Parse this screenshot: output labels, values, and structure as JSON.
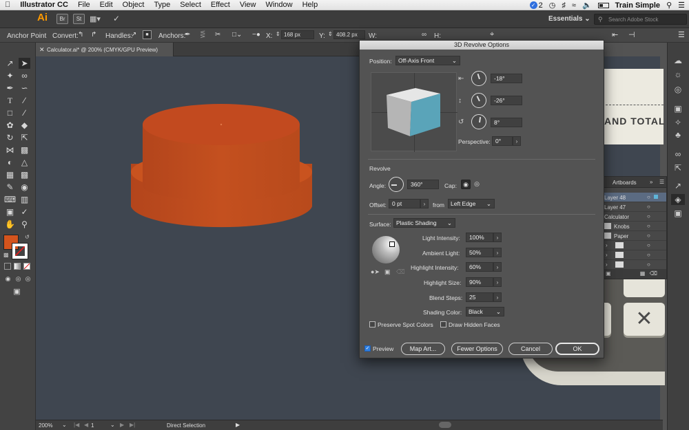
{
  "menubar": {
    "app_name": "Illustrator CC",
    "items": [
      "File",
      "Edit",
      "Object",
      "Type",
      "Select",
      "Effect",
      "View",
      "Window",
      "Help"
    ],
    "notif_count": "2",
    "user": "Train Simple"
  },
  "appbar": {
    "ai_label": "Ai",
    "br_label": "Br",
    "st_label": "St",
    "workspace": "Essentials",
    "stock_placeholder": "Search Adobe Stock"
  },
  "control": {
    "anchor_point": "Anchor Point",
    "convert": "Convert:",
    "handles": "Handles:",
    "anchors": "Anchors:",
    "x_label": "X:",
    "x_value": "168 px",
    "y_label": "Y:",
    "y_value": "408.2 px",
    "w_label": "W:",
    "h_label": "H:"
  },
  "tab": {
    "title": "Calculator.ai* @ 200% (CMYK/GPU Preview)"
  },
  "status": {
    "zoom": "200%",
    "page": "1",
    "tool": "Direct Selection"
  },
  "layers": {
    "tab_artboards": "Artboards",
    "rows": [
      "Layer 48",
      "Layer 47",
      "Calculator",
      "Knobs",
      "Paper"
    ]
  },
  "artwork": {
    "receipt_text": "AND TOTAL"
  },
  "dialog": {
    "title": "3D Revolve Options",
    "position_label": "Position:",
    "position_value": "Off-Axis Front",
    "rot_x": "-18°",
    "rot_y": "-26°",
    "rot_z": "8°",
    "perspective_label": "Perspective:",
    "perspective_value": "0°",
    "revolve_header": "Revolve",
    "angle_label": "Angle:",
    "angle_value": "360°",
    "cap_label": "Cap:",
    "offset_label": "Offset:",
    "offset_value": "0 pt",
    "from_label": "from",
    "from_value": "Left Edge",
    "surface_label": "Surface:",
    "surface_value": "Plastic Shading",
    "light_intensity_label": "Light Intensity:",
    "light_intensity_value": "100%",
    "ambient_label": "Ambient Light:",
    "ambient_value": "50%",
    "highlight_int_label": "Highlight Intensity:",
    "highlight_int_value": "60%",
    "highlight_size_label": "Highlight Size:",
    "highlight_size_value": "90%",
    "blend_label": "Blend Steps:",
    "blend_value": "25",
    "shading_label": "Shading Color:",
    "shading_value": "Black",
    "preserve_spot": "Preserve Spot Colors",
    "draw_hidden": "Draw Hidden Faces",
    "preview_label": "Preview",
    "map_art": "Map Art...",
    "fewer_options": "Fewer Options",
    "cancel": "Cancel",
    "ok": "OK"
  },
  "colors": {
    "cube_front": "#5aa4b9",
    "cube_side": "#b5b5b5",
    "cube_top": "#e6e6e6",
    "object_orange": "#c24a1f",
    "fill_swatch": "#d4541d"
  }
}
